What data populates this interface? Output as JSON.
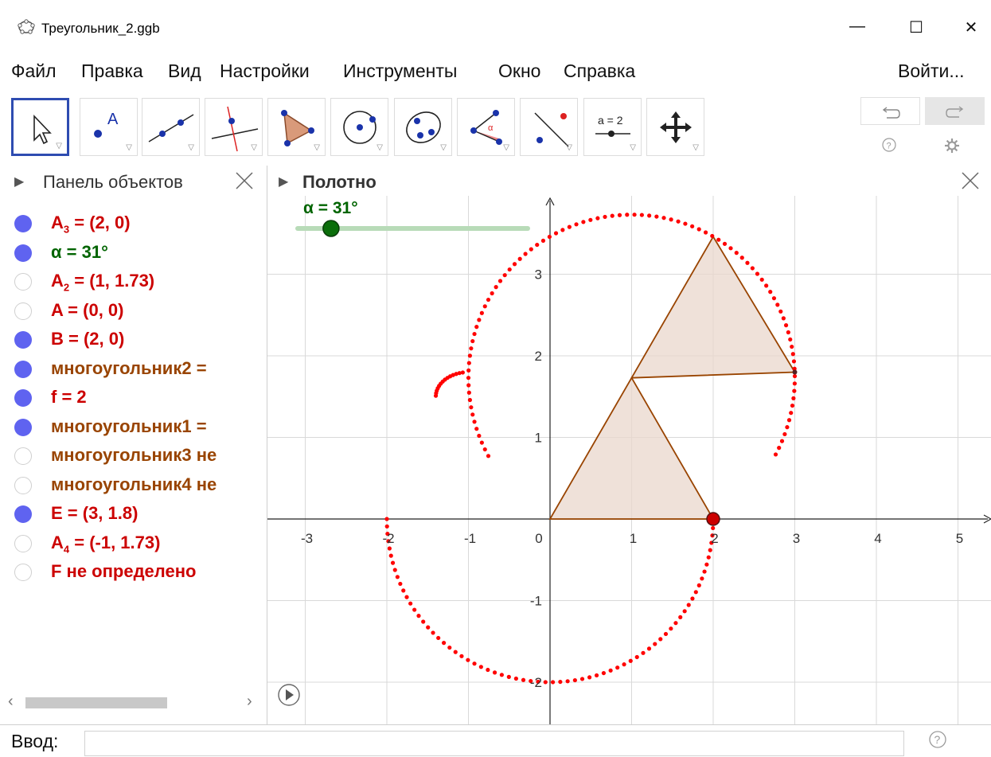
{
  "window": {
    "title": "Треугольник_2.ggb",
    "minimize": "—",
    "maximize": "☐",
    "close": "✕"
  },
  "menu": {
    "items": [
      "Файл",
      "Правка",
      "Вид",
      "Настройки",
      "Инструменты",
      "Окно",
      "Справка"
    ],
    "login": "Войти..."
  },
  "toolbar": {
    "tools": [
      "move-tool",
      "point-tool",
      "line-tool",
      "perpendicular-line-tool",
      "polygon-tool",
      "circle-tool",
      "ellipse-tool",
      "angle-tool",
      "reflect-tool",
      "slider-tool",
      "move-graphics-tool"
    ],
    "slider_label": "a = 2",
    "undo_icon": "undo-icon",
    "redo_icon": "redo-icon",
    "help_icon": "help-icon",
    "settings_icon": "gear-icon"
  },
  "algebra": {
    "title": "Панель объектов",
    "rows": [
      {
        "pre": "A",
        "sub": "3",
        "post": " = (2, 0)",
        "color": "#cc0000",
        "visible": true
      },
      {
        "pre": "α = 31°",
        "sub": "",
        "post": "",
        "color": "#006400",
        "visible": true
      },
      {
        "pre": "A",
        "sub": "2",
        "post": " = (1, 1.73)",
        "color": "#cc0000",
        "visible": false
      },
      {
        "pre": "A = (0, 0)",
        "sub": "",
        "post": "",
        "color": "#cc0000",
        "visible": false
      },
      {
        "pre": "B = (2, 0)",
        "sub": "",
        "post": "",
        "color": "#cc0000",
        "visible": true
      },
      {
        "pre": "многоугольник2 = ",
        "sub": "",
        "post": "",
        "color": "#994400",
        "visible": true
      },
      {
        "pre": "f = 2",
        "sub": "",
        "post": "",
        "color": "#cc0000",
        "visible": true
      },
      {
        "pre": "многоугольник1 = ",
        "sub": "",
        "post": "",
        "color": "#994400",
        "visible": true
      },
      {
        "pre": "многоугольник3 не",
        "sub": "",
        "post": "",
        "color": "#994400",
        "visible": false
      },
      {
        "pre": "многоугольник4 не",
        "sub": "",
        "post": "",
        "color": "#994400",
        "visible": false
      },
      {
        "pre": "E = (3, 1.8)",
        "sub": "",
        "post": "",
        "color": "#cc0000",
        "visible": true
      },
      {
        "pre": "A",
        "sub": "4",
        "post": " = (-1, 1.73)",
        "color": "#cc0000",
        "visible": false
      },
      {
        "pre": "F не определено",
        "sub": "",
        "post": "",
        "color": "#cc0000",
        "visible": false
      }
    ],
    "scroll_left": "‹",
    "scroll_right": "›"
  },
  "graphics": {
    "title": "Полотно",
    "slider_text": "α = 31°",
    "slider_value_deg": 31,
    "x_ticks": [
      "-3",
      "-2",
      "-1",
      "0",
      "1",
      "2",
      "3",
      "4",
      "5"
    ],
    "y_ticks": [
      "3",
      "2",
      "1",
      "-1",
      "-2"
    ],
    "x_range": [
      -3.4,
      5.4
    ],
    "y_range": [
      -2.3,
      3.8
    ],
    "triangle1": [
      [
        0,
        0
      ],
      [
        2,
        0
      ],
      [
        1,
        1.73
      ]
    ],
    "triangle2": [
      [
        1,
        1.73
      ],
      [
        3,
        1.8
      ],
      [
        2,
        3.46
      ]
    ],
    "point_B": [
      2,
      0
    ],
    "point_E": [
      3,
      1.8
    ],
    "colors": {
      "locus": "#ff0000",
      "polygon_stroke": "#994400",
      "polygon_fill": "#e9d7cc",
      "slider": "#006400"
    }
  },
  "input": {
    "label": "Ввод:",
    "value": "",
    "help_icon": "help-icon"
  }
}
